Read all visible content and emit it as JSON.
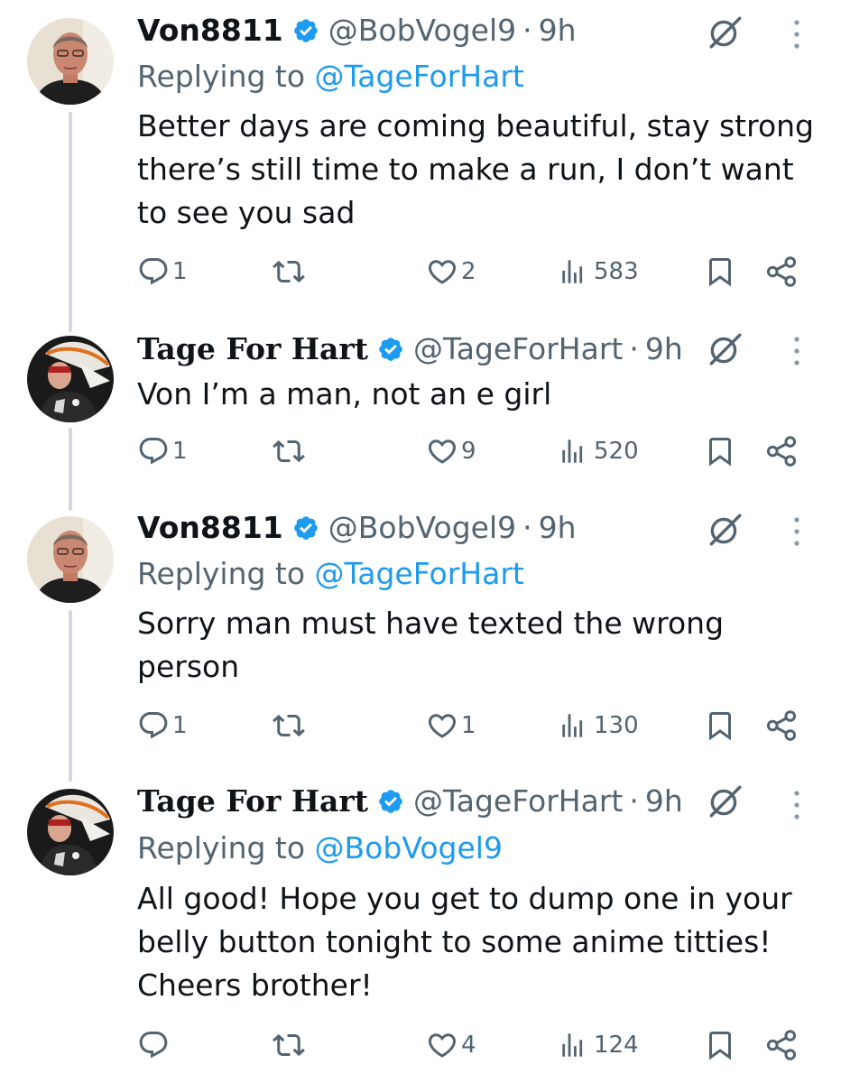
{
  "tweets": [
    {
      "name": "Von8811",
      "handle": "@BobVogel9",
      "dot": "·",
      "time": "9h",
      "reply_prefix": "Replying to",
      "reply_mention": "@TageForHart",
      "text": "Better days are coming beautiful, stay strong there’s still time to make a run, I don’t want to see you sad",
      "replies": "1",
      "retweets": "",
      "likes": "2",
      "views": "583"
    },
    {
      "name": "Tage For Hart",
      "handle": "@TageForHart",
      "dot": "·",
      "time": "9h",
      "reply_prefix": "",
      "reply_mention": "",
      "text": "Von I’m a man, not an e girl",
      "replies": "1",
      "retweets": "",
      "likes": "9",
      "views": "520"
    },
    {
      "name": "Von8811",
      "handle": "@BobVogel9",
      "dot": "·",
      "time": "9h",
      "reply_prefix": "Replying to",
      "reply_mention": "@TageForHart",
      "text": "Sorry man must have texted the wrong person",
      "replies": "1",
      "retweets": "",
      "likes": "1",
      "views": "130"
    },
    {
      "name": "Tage For Hart",
      "handle": "@TageForHart",
      "dot": "·",
      "time": "9h",
      "reply_prefix": "Replying to",
      "reply_mention": "@BobVogel9",
      "text": "All good! Hope you get to dump one in your belly button tonight to some anime titties! Cheers brother!",
      "replies": "",
      "retweets": "",
      "likes": "4",
      "views": "124"
    }
  ],
  "icons": {
    "verified": "verified-badge-icon",
    "grok": "grok-icon",
    "more": "more-options-icon",
    "reply": "reply-icon",
    "retweet": "retweet-icon",
    "like": "heart-icon",
    "views": "views-chart-icon",
    "bookmark": "bookmark-icon",
    "share": "share-icon"
  },
  "colors": {
    "text": "#0f1419",
    "secondary": "#536471",
    "link": "#1d9bf0",
    "thread_line": "#cfd9de"
  }
}
